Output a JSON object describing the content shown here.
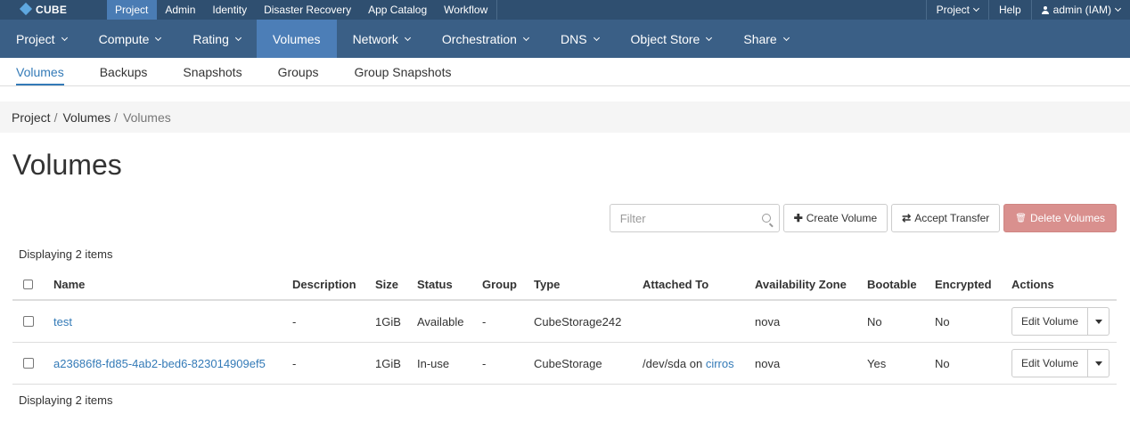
{
  "brand": {
    "name": "CUBE"
  },
  "topnav": {
    "items": [
      {
        "label": "Project",
        "active": true
      },
      {
        "label": "Admin"
      },
      {
        "label": "Identity"
      },
      {
        "label": "Disaster Recovery"
      },
      {
        "label": "App Catalog"
      },
      {
        "label": "Workflow"
      }
    ],
    "project_menu": "Project",
    "help": "Help",
    "user": "admin (IAM)"
  },
  "mainnav": {
    "items": [
      {
        "label": "Project",
        "dropdown": true
      },
      {
        "label": "Compute",
        "dropdown": true
      },
      {
        "label": "Rating",
        "dropdown": true
      },
      {
        "label": "Volumes",
        "dropdown": false,
        "active": true
      },
      {
        "label": "Network",
        "dropdown": true
      },
      {
        "label": "Orchestration",
        "dropdown": true
      },
      {
        "label": "DNS",
        "dropdown": true
      },
      {
        "label": "Object Store",
        "dropdown": true
      },
      {
        "label": "Share",
        "dropdown": true
      }
    ]
  },
  "subtabs": {
    "items": [
      {
        "label": "Volumes",
        "active": true
      },
      {
        "label": "Backups"
      },
      {
        "label": "Snapshots"
      },
      {
        "label": "Groups"
      },
      {
        "label": "Group Snapshots"
      }
    ]
  },
  "breadcrumb": {
    "items": [
      "Project",
      "Volumes",
      "Volumes"
    ],
    "separator": "/"
  },
  "page": {
    "title": "Volumes"
  },
  "toolbar": {
    "filter_placeholder": "Filter",
    "create_label": "Create Volume",
    "accept_label": "Accept Transfer",
    "delete_label": "Delete Volumes"
  },
  "table": {
    "count_text": "Displaying 2 items",
    "columns": [
      "Name",
      "Description",
      "Size",
      "Status",
      "Group",
      "Type",
      "Attached To",
      "Availability Zone",
      "Bootable",
      "Encrypted",
      "Actions"
    ],
    "rows": [
      {
        "name": "test",
        "description": "-",
        "size": "1GiB",
        "status": "Available",
        "group": "-",
        "type": "CubeStorage242",
        "attached_prefix": "",
        "attached_link": "",
        "zone": "nova",
        "bootable": "No",
        "encrypted": "No",
        "action": "Edit Volume"
      },
      {
        "name": "a23686f8-fd85-4ab2-bed6-823014909ef5",
        "description": "-",
        "size": "1GiB",
        "status": "In-use",
        "group": "-",
        "type": "CubeStorage",
        "attached_prefix": "/dev/sda on ",
        "attached_link": "cirros",
        "zone": "nova",
        "bootable": "Yes",
        "encrypted": "No",
        "action": "Edit Volume"
      }
    ]
  },
  "colors": {
    "topbar": "#2f4f70",
    "mainnav": "#3a5f86",
    "active_nav": "#4c7eb7",
    "link": "#337ab7",
    "danger": "#d9908e"
  }
}
